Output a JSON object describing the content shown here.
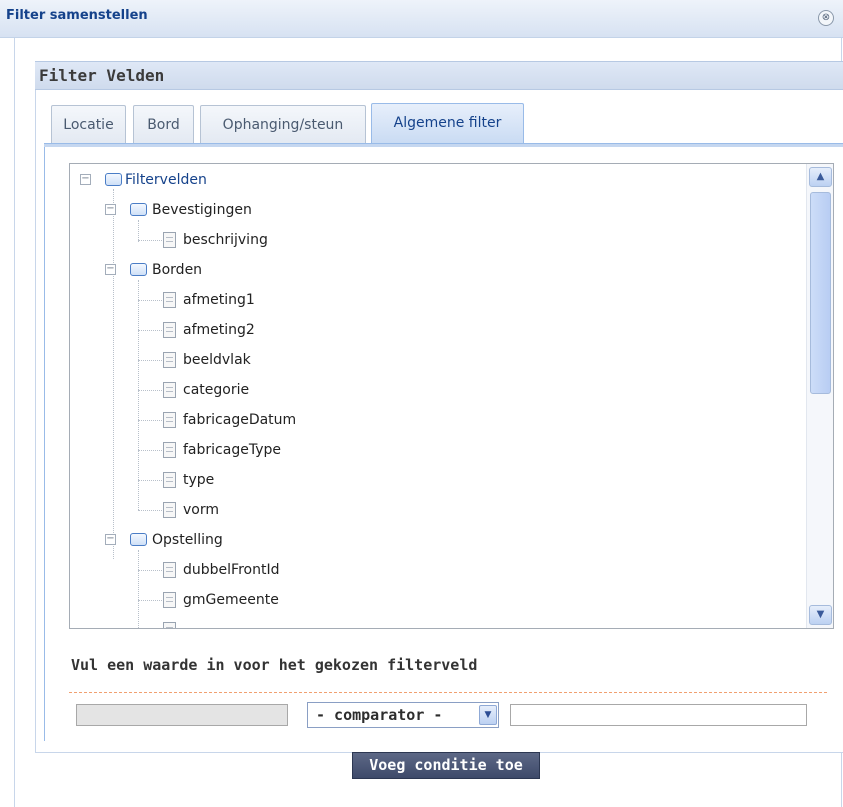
{
  "dialog": {
    "title": "Filter samenstellen",
    "close_glyph": "⊗"
  },
  "panel": {
    "title": "Filter Velden"
  },
  "tabs": [
    {
      "label": "Locatie",
      "active": false
    },
    {
      "label": "Bord",
      "active": false
    },
    {
      "label": "Ophanging/steun",
      "active": false
    },
    {
      "label": "Algemene filter",
      "active": true
    }
  ],
  "tree": {
    "root": "Filtervelden",
    "groups": [
      {
        "label": "Bevestigingen",
        "children": [
          "beschrijving"
        ]
      },
      {
        "label": "Borden",
        "children": [
          "afmeting1",
          "afmeting2",
          "beeldvlak",
          "categorie",
          "fabricageDatum",
          "fabricageType",
          "type",
          "vorm"
        ]
      },
      {
        "label": "Opstelling",
        "children": [
          "dubbelFrontId",
          "gmGemeente"
        ]
      }
    ]
  },
  "form": {
    "title": "Vul een waarde in voor het gekozen filterveld",
    "comparator_value": "- comparator -",
    "submit_label": "Voeg conditie toe"
  },
  "icons": {
    "folder": "folder-icon",
    "leaf": "document-icon",
    "expander": "collapse-icon"
  },
  "colors": {
    "accent": "#15428b",
    "tab_active": "#c9dbf3",
    "button_bg": "#4a5575"
  }
}
